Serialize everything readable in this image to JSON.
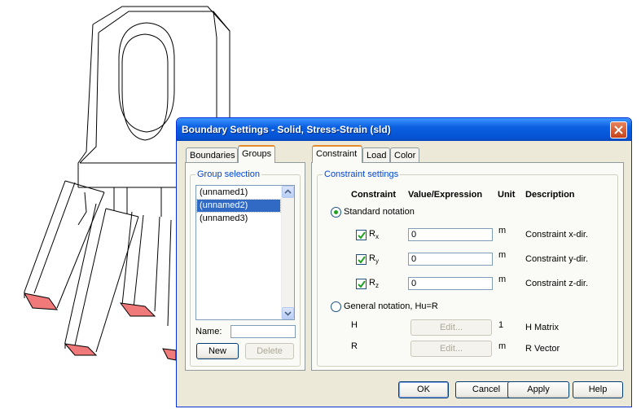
{
  "dialog": {
    "title": "Boundary Settings - Solid, Stress-Strain (sld)",
    "close_icon": "close-icon"
  },
  "left_tabs": [
    {
      "label": "Boundaries",
      "active": false
    },
    {
      "label": "Groups",
      "active": true
    }
  ],
  "group_selection": {
    "legend": "Group selection",
    "items": [
      "(unnamed1)",
      "(unnamed2)",
      "(unnamed3)"
    ],
    "selected_index": 1,
    "name_label": "Name:",
    "name_value": "",
    "new_label": "New",
    "delete_label": "Delete"
  },
  "right_tabs": [
    {
      "label": "Constraint",
      "active": true
    },
    {
      "label": "Load",
      "active": false
    },
    {
      "label": "Color",
      "active": false
    }
  ],
  "constraint_settings": {
    "legend": "Constraint settings",
    "headers": {
      "constraint": "Constraint",
      "value": "Value/Expression",
      "unit": "Unit",
      "description": "Description"
    },
    "standard_notation_label": "Standard notation",
    "standard_selected": true,
    "rows": [
      {
        "symbol": "R",
        "sub": "x",
        "checked": true,
        "value": "0",
        "unit": "m",
        "description": "Constraint x-dir."
      },
      {
        "symbol": "R",
        "sub": "y",
        "checked": true,
        "value": "0",
        "unit": "m",
        "description": "Constraint y-dir."
      },
      {
        "symbol": "R",
        "sub": "z",
        "checked": true,
        "value": "0",
        "unit": "m",
        "description": "Constraint z-dir."
      }
    ],
    "general_notation_label": "General notation, Hu=R",
    "general_selected": false,
    "general_rows": [
      {
        "symbol": "H",
        "button": "Edit...",
        "unit": "1",
        "description": "H Matrix"
      },
      {
        "symbol": "R",
        "button": "Edit...",
        "unit": "m",
        "description": "R Vector"
      }
    ]
  },
  "footer": {
    "ok_label": "OK",
    "cancel_label": "Cancel",
    "apply_label": "Apply",
    "help_label": "Help"
  },
  "colors": {
    "title_bar": "#0553d4",
    "highlight_face": "#f07a7a",
    "selection": "#316ac5"
  }
}
